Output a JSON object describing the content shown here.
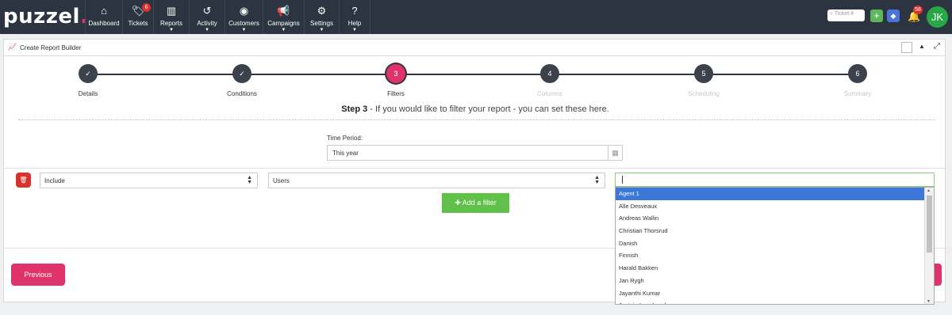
{
  "logo": {
    "text_a": "p",
    "text_b": "zzel",
    "dot": "."
  },
  "nav": [
    {
      "label": "Dashboard",
      "icon": "home-icon",
      "glyph": "⌂",
      "caret": false
    },
    {
      "label": "Tickets",
      "icon": "tags-icon",
      "glyph": "🏷",
      "caret": false,
      "badge": "6"
    },
    {
      "label": "Reports",
      "icon": "bar-chart-icon",
      "glyph": "▥",
      "caret": true
    },
    {
      "label": "Activity",
      "icon": "history-icon",
      "glyph": "↺",
      "caret": true
    },
    {
      "label": "Customers",
      "icon": "user-circle-icon",
      "glyph": "◉",
      "caret": true
    },
    {
      "label": "Campaigns",
      "icon": "megaphone-icon",
      "glyph": "📢",
      "caret": true
    },
    {
      "label": "Settings",
      "icon": "gear-icon",
      "glyph": "⚙",
      "caret": true
    },
    {
      "label": "Help",
      "icon": "question-icon",
      "glyph": "?",
      "caret": true
    }
  ],
  "topright": {
    "search_placeholder": "Ticket #",
    "notifications_count": "58",
    "avatar_initials": "JK"
  },
  "panel": {
    "title": "Create Report Builder"
  },
  "steps": [
    {
      "number": "✓",
      "label": "Details",
      "state": "done"
    },
    {
      "number": "✓",
      "label": "Conditions",
      "state": "done"
    },
    {
      "number": "3",
      "label": "Filters",
      "state": "active"
    },
    {
      "number": "4",
      "label": "Columns",
      "state": "todo"
    },
    {
      "number": "5",
      "label": "Scheduling",
      "state": "todo"
    },
    {
      "number": "6",
      "label": "Summary",
      "state": "todo"
    }
  ],
  "instruction": {
    "step": "Step 3",
    "text": " - If you would like to filter your report - you can set these here."
  },
  "time_period": {
    "label": "Time Period:",
    "value": "This year"
  },
  "filter": {
    "mode": "Include",
    "field": "Users",
    "add_label": "Add a filter"
  },
  "dropdown": {
    "search_value": "",
    "selected": "Agent 1",
    "options": [
      "Agent 1",
      "Alle Desveaux",
      "Andreas Wallin",
      "Christian Thorsrud",
      "Danish",
      "Finnish",
      "Harald Bakken",
      "Jan Rygh",
      "Jayanthi Kumar",
      "Jostein Inge Lund"
    ]
  },
  "footer": {
    "previous_label": "Previous"
  },
  "colors": {
    "topbar": "#2b3440",
    "accent": "#e0336b",
    "success": "#5fc04a",
    "danger": "#d9312c",
    "selected": "#3b78d8"
  }
}
